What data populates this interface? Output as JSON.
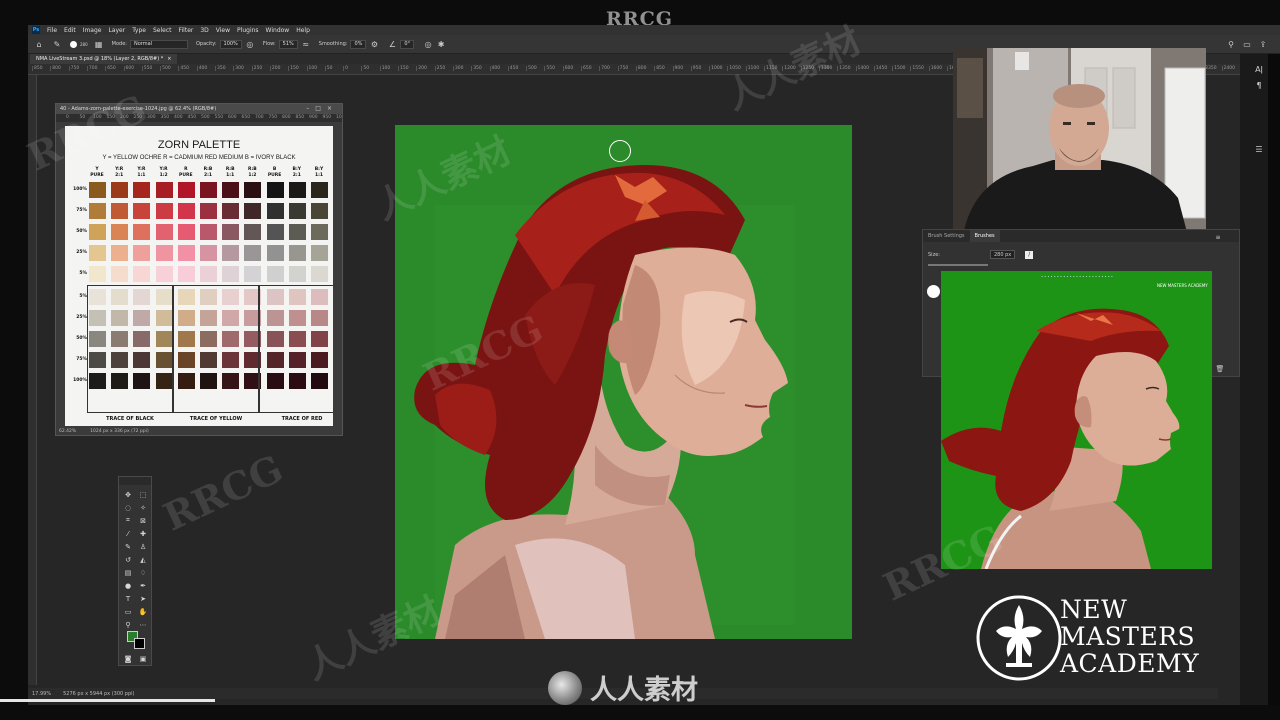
{
  "watermark": {
    "top": "RRCG",
    "bottom": "人人素材"
  },
  "menu": {
    "items": [
      "File",
      "Edit",
      "Image",
      "Layer",
      "Type",
      "Select",
      "Filter",
      "3D",
      "View",
      "Plugins",
      "Window",
      "Help"
    ]
  },
  "options": {
    "mode_label": "Mode:",
    "mode_value": "Normal",
    "opacity_label": "Opacity:",
    "opacity_value": "100%",
    "flow_label": "Flow:",
    "flow_value": "51%",
    "smoothing_label": "Smoothing:",
    "smoothing_value": "0%",
    "angle_value": "0°",
    "brush_size": "280"
  },
  "document": {
    "tab": "NMA LiveStream 3.psd @ 18% (Layer 2, RGB/8#) *"
  },
  "ruler": {
    "ticks": [
      "850",
      "800",
      "750",
      "700",
      "650",
      "600",
      "550",
      "500",
      "450",
      "400",
      "350",
      "300",
      "250",
      "200",
      "150",
      "100",
      "50",
      "0",
      "50",
      "100",
      "150",
      "200",
      "250",
      "300",
      "350",
      "400",
      "450",
      "500",
      "550",
      "600",
      "650",
      "700",
      "750",
      "800",
      "850",
      "900",
      "950",
      "1000",
      "1050",
      "1100",
      "1150",
      "1200",
      "1250",
      "1300",
      "1350",
      "1400",
      "1450",
      "1500",
      "1550",
      "1600",
      "1650",
      "1700",
      "1750",
      "1800",
      "1850",
      "1900",
      "1950",
      "2000",
      "2050",
      "2100",
      "2150",
      "2200",
      "2250",
      "2300",
      "2350",
      "2400",
      "2450",
      "2500",
      "2550"
    ]
  },
  "status": {
    "zoom": "17.99%",
    "doc_size": "5276 px x 5944 px (300 ppi)"
  },
  "ref_window": {
    "title": "40 - Adams-zorn-palette-exercise-1024.jpg @ 62.4% (RGB/8#)",
    "ruler": [
      "0",
      "50",
      "100",
      "150",
      "200",
      "250",
      "300",
      "350",
      "400",
      "450",
      "500",
      "550",
      "600",
      "650",
      "700",
      "750",
      "800",
      "850",
      "900",
      "950",
      "1000"
    ],
    "zoom": "62.42%",
    "size": "1024 px x 336 px (72 ppi)",
    "palette": {
      "title": "ZORN PALETTE",
      "legend": "Y = YELLOW OCHRE    R = CADMIUM RED MEDIUM    B = IVORY BLACK",
      "columns": [
        [
          "Y",
          "PURE"
        ],
        [
          "Y:R",
          "2:1"
        ],
        [
          "Y:R",
          "1:1"
        ],
        [
          "Y:R",
          "1:2"
        ],
        [
          "R",
          "PURE"
        ],
        [
          "R:B",
          "2:1"
        ],
        [
          "R:B",
          "1:1"
        ],
        [
          "R:B",
          "1:2"
        ],
        [
          "B",
          "PURE"
        ],
        [
          "B:Y",
          "2:1"
        ],
        [
          "B:Y",
          "1:1"
        ]
      ],
      "top_rows": [
        "100%",
        "75%",
        "50%",
        "25%",
        "5%"
      ],
      "bottom_rows": [
        "5%",
        "25%",
        "50%",
        "75%",
        "100%"
      ],
      "traces": [
        "TRACE OF BLACK",
        "TRACE OF YELLOW",
        "TRACE OF RED"
      ],
      "top_colors": [
        [
          "#8a5a1e",
          "#9a3a1a",
          "#a4261c",
          "#a81c24",
          "#b01628",
          "#7a1420",
          "#4a1218",
          "#2a1012",
          "#141414",
          "#1c1a16",
          "#2a261c"
        ],
        [
          "#b07c38",
          "#c05a34",
          "#c8443a",
          "#cc3a44",
          "#d2344a",
          "#9a3040",
          "#6a2c34",
          "#402828",
          "#303030",
          "#3a3a32",
          "#4a4636"
        ],
        [
          "#d0a458",
          "#da8456",
          "#e0705e",
          "#e26270",
          "#e65a72",
          "#b8586a",
          "#8a5860",
          "#625656",
          "#545454",
          "#5c5c54",
          "#6c6a5a"
        ],
        [
          "#e4c690",
          "#ecb08e",
          "#f0a09a",
          "#f094a2",
          "#f290a6",
          "#d694a2",
          "#b49aa0",
          "#9a9698",
          "#929292",
          "#979790",
          "#a6a496"
        ],
        [
          "#f2e6cc",
          "#f6dccc",
          "#f8d6d4",
          "#f8d0d8",
          "#f8ccd8",
          "#ecd0d8",
          "#ded2d6",
          "#d4d2d4",
          "#d0d0d0",
          "#d2d2ce",
          "#dad8d0"
        ]
      ],
      "bottom_colors": [
        [
          "#e8e2d8",
          "#e4dccc",
          "#e4d6d2",
          "#e6dec8",
          "#e8d6b8",
          "#e0cec0",
          "#e8d0d0",
          "#e4c8c8",
          "#dcc4c4",
          "#e0c4c0",
          "#dcbcbc"
        ],
        [
          "#c4c0b6",
          "#c2b8aa",
          "#c0aaa8",
          "#d0bc98",
          "#d0ac88",
          "#c4a498",
          "#d0a8a8",
          "#c89c9c",
          "#bc9494",
          "#c09090",
          "#b88888"
        ],
        [
          "#8a8680",
          "#8a7c70",
          "#886a6a",
          "#a08658",
          "#a0784c",
          "#8c6c60",
          "#a06a6c",
          "#945c60",
          "#885256",
          "#8a4e52",
          "#804448"
        ],
        [
          "#4e4a46",
          "#4e423c",
          "#4c3636",
          "#685032",
          "#6a4428",
          "#503a32",
          "#6a3438",
          "#602a30",
          "#54262a",
          "#56222a",
          "#4a1c22"
        ],
        [
          "#1e1c1a",
          "#1e1a16",
          "#1e1414",
          "#342414",
          "#341c10",
          "#201410",
          "#361418",
          "#301014",
          "#280e12",
          "#2a0c12",
          "#220a0e"
        ]
      ]
    }
  },
  "brush_panel": {
    "tabs": [
      "Brush Settings",
      "Brushes"
    ],
    "size_label": "Size:",
    "size_value": "280 px"
  },
  "ref_photo": {
    "logo_tiny": "NEW MASTERS ACADEMY"
  },
  "logo": {
    "lines": [
      "NEW",
      "MASTERS",
      "ACADEMY"
    ]
  },
  "colors": {
    "foreground": "#2a7d2a",
    "background": "#000000",
    "canvas_green": "#2b8a2a",
    "photo_green": "#1e9416"
  }
}
